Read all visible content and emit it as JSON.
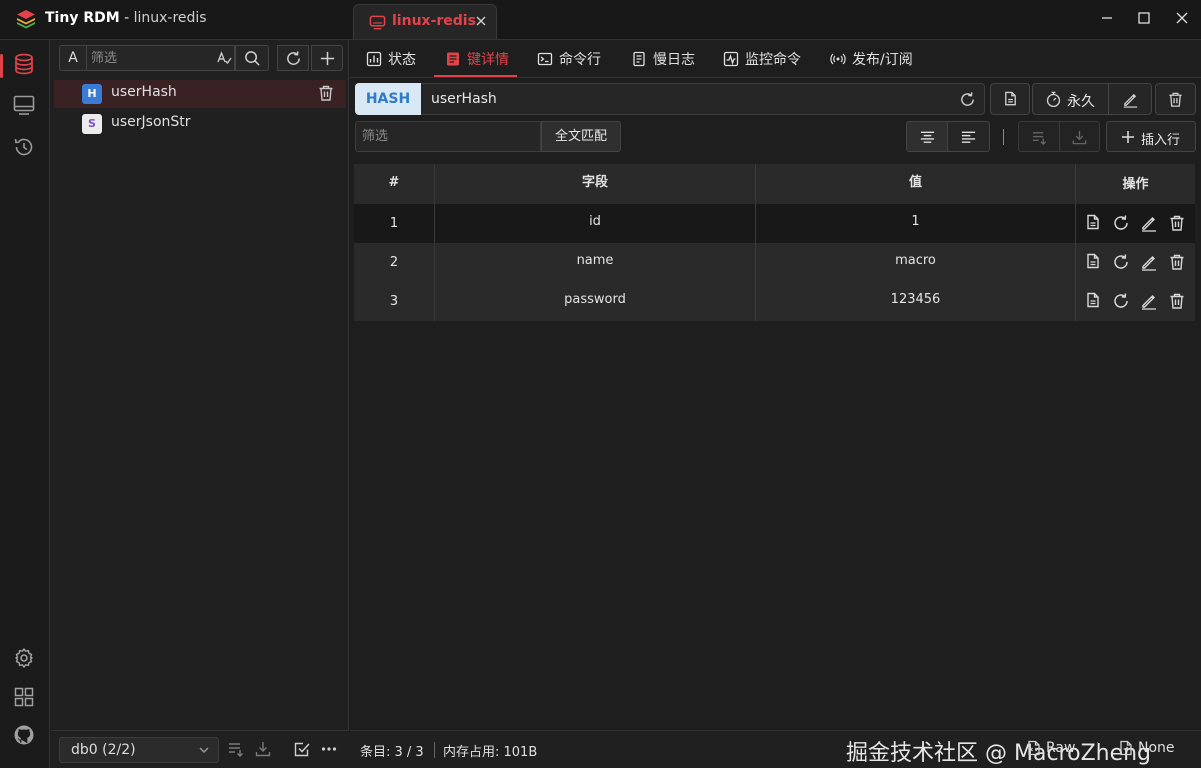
{
  "app": {
    "name": "Tiny RDM",
    "separator": " - ",
    "connection": "linux-redis"
  },
  "connection_tab": {
    "label": "linux-redis"
  },
  "key_panel": {
    "filter_type": "A",
    "filter_placeholder": "筛选",
    "keys": [
      {
        "type": "H",
        "name": "userHash",
        "selected": true
      },
      {
        "type": "S",
        "name": "userJsonStr",
        "selected": false
      }
    ],
    "db_select": "db0 (2/2)"
  },
  "detail_tabs": [
    {
      "label": "状态",
      "icon": "status-icon"
    },
    {
      "label": "键详情",
      "icon": "key-detail-icon",
      "active": true
    },
    {
      "label": "命令行",
      "icon": "terminal-icon"
    },
    {
      "label": "慢日志",
      "icon": "slow-log-icon"
    },
    {
      "label": "监控命令",
      "icon": "monitor-icon"
    },
    {
      "label": "发布/订阅",
      "icon": "pubsub-icon"
    }
  ],
  "key_detail": {
    "type": "HASH",
    "key": "userHash",
    "ttl_label": "永久",
    "value_filter_placeholder": "筛选",
    "full_match_label": "全文匹配",
    "insert_row_label": "插入行",
    "columns": [
      "#",
      "字段",
      "值",
      "操作"
    ],
    "rows": [
      {
        "no": "1",
        "field": "id",
        "value": "1"
      },
      {
        "no": "2",
        "field": "name",
        "value": "macro"
      },
      {
        "no": "3",
        "field": "password",
        "value": "123456"
      }
    ]
  },
  "footer": {
    "entries": "条目: 3 / 3",
    "memory": "内存占用: 101B",
    "watermark": "掘金技术社区 @ MacroZheng",
    "view_format": "Raw",
    "decode_format": "None"
  },
  "colors": {
    "accent": "#e2434b",
    "hash_badge_bg": "#d9e8f5",
    "hash_badge_text": "#2f7bc4",
    "key_type_hash": "#3a7bd5",
    "key_type_string": "#7a4fd3"
  }
}
